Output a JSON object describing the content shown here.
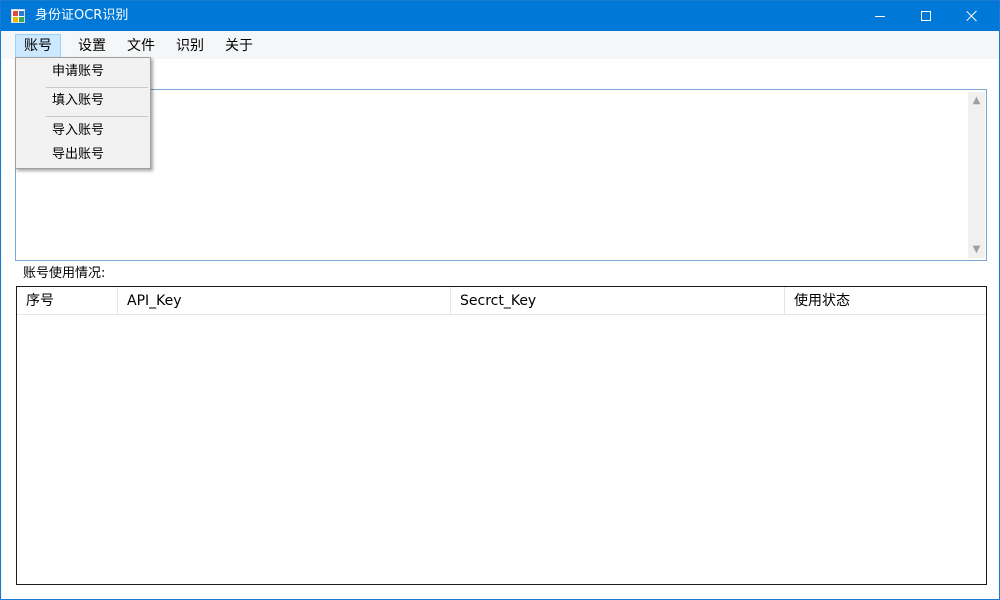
{
  "window": {
    "title": "身份证OCR识别",
    "icon": "app-icon"
  },
  "menubar": {
    "items": [
      {
        "label": "账号",
        "active": true
      },
      {
        "label": "设置"
      },
      {
        "label": "文件"
      },
      {
        "label": "识别"
      },
      {
        "label": "关于"
      }
    ]
  },
  "account_menu": {
    "items": [
      {
        "label": "申请账号"
      },
      {
        "label": "填入账号"
      },
      {
        "label": "导入账号"
      },
      {
        "label": "导出账号"
      }
    ]
  },
  "usage": {
    "label": "账号使用情况:",
    "columns": [
      "序号",
      "API_Key",
      "Secrct_Key",
      "使用状态"
    ],
    "rows": []
  },
  "colors": {
    "titlebar": "#0078d7",
    "menu_active": "#cce8ff",
    "border_accent": "#7aa7d3"
  }
}
